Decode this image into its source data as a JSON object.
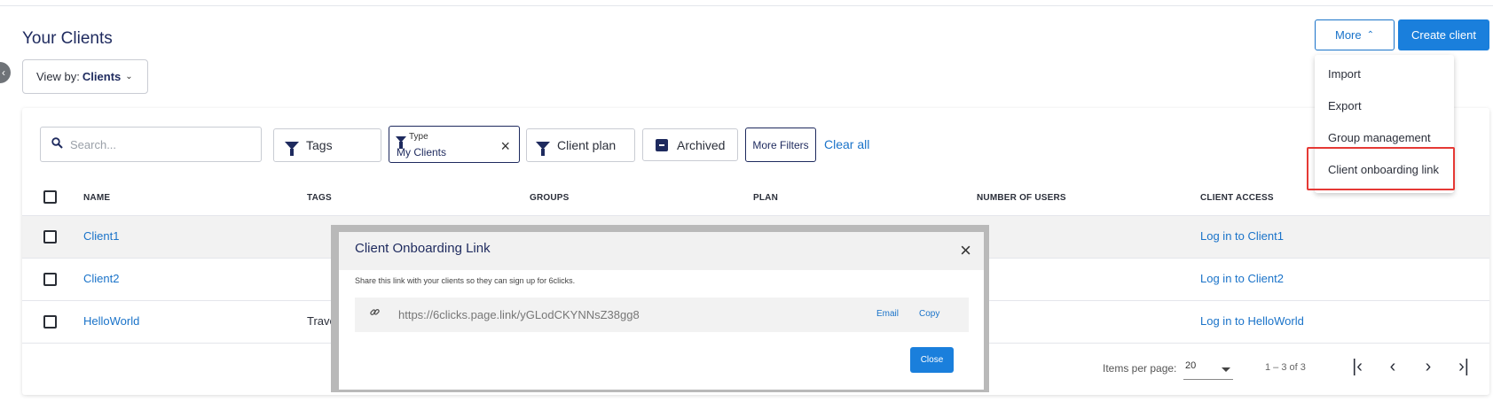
{
  "page": {
    "title": "Your Clients",
    "view_by": {
      "label": "View by:",
      "value": "Clients"
    }
  },
  "actions": {
    "more_label": "More",
    "create_label": "Create client",
    "menu": [
      {
        "label": "Import"
      },
      {
        "label": "Export"
      },
      {
        "label": "Group management"
      },
      {
        "label": "Client onboarding link"
      }
    ]
  },
  "filters": {
    "search_placeholder": "Search...",
    "tags": "Tags",
    "type_label": "Type",
    "type_value": "My Clients",
    "client_plan": "Client plan",
    "archived": "Archived",
    "more_filters": "More Filters",
    "clear_all": "Clear all"
  },
  "table": {
    "columns": [
      "NAME",
      "TAGS",
      "GROUPS",
      "PLAN",
      "NUMBER OF USERS",
      "CLIENT ACCESS"
    ],
    "rows": [
      {
        "name": "Client1",
        "tags": "",
        "access": "Log in to Client1"
      },
      {
        "name": "Client2",
        "tags": "",
        "access": "Log in to Client2"
      },
      {
        "name": "HelloWorld",
        "tags": "Trave",
        "access": "Log in to HelloWorld"
      }
    ]
  },
  "pagination": {
    "items_per_page_label": "Items per page:",
    "items_per_page": "20",
    "range": "1 – 3 of 3"
  },
  "modal": {
    "title": "Client Onboarding Link",
    "description": "Share this link with your clients so they can sign up for 6clicks.",
    "link": "https://6clicks.page.link/yGLodCKYNNsZ38gg8",
    "email_label": "Email",
    "copy_label": "Copy",
    "close_label": "Close"
  },
  "colors": {
    "primary": "#1a7fdc",
    "link": "#1a73c9",
    "navy": "#1e2a5e",
    "highlight_border": "#e53935"
  }
}
